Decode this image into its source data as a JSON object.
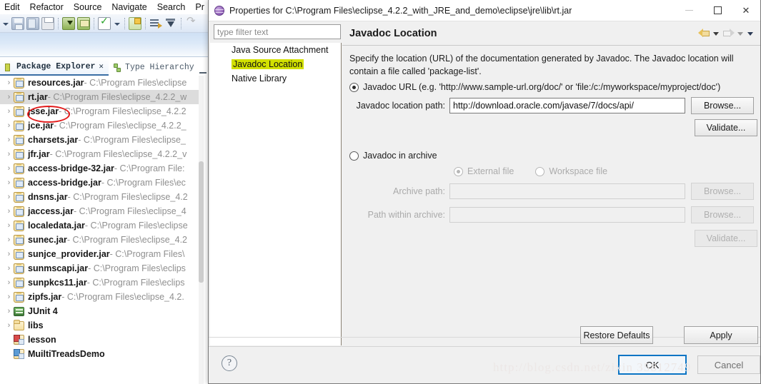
{
  "eclipse": {
    "menu": [
      "Edit",
      "Refactor",
      "Source",
      "Navigate",
      "Search",
      "Pr"
    ],
    "toolbar_icons": [
      "caret-down-icon",
      "save-icon",
      "save-all-icon",
      "print-icon",
      "export-icon",
      "update-icon",
      "check-icon",
      "caret-down-icon",
      "new-class-icon",
      "open-type-icon",
      "debug-tree-icon",
      "redo-icon"
    ],
    "view_tabs": [
      {
        "label": "Package Explorer",
        "icon": "package-icon",
        "close": "✕"
      },
      {
        "label": "Type Hierarchy",
        "icon": "hierarchy-icon",
        "close": ""
      }
    ],
    "tree": [
      {
        "name": "resources.jar",
        "path": " - C:\\Program Files\\eclipse",
        "icon": "jar-icon",
        "expander": "›",
        "selected": false
      },
      {
        "name": "rt.jar",
        "path": " - C:\\Program Files\\eclipse_4.2.2_w",
        "icon": "jar-icon",
        "expander": "›",
        "selected": true
      },
      {
        "name": "jsse.jar",
        "path": " - C:\\Program Files\\eclipse_4.2.2",
        "icon": "jar-icon",
        "expander": "›",
        "selected": false
      },
      {
        "name": "jce.jar",
        "path": " - C:\\Program Files\\eclipse_4.2.2_",
        "icon": "jar-icon",
        "expander": "›",
        "selected": false
      },
      {
        "name": "charsets.jar",
        "path": " - C:\\Program Files\\eclipse_",
        "icon": "jar-icon",
        "expander": "›",
        "selected": false
      },
      {
        "name": "jfr.jar",
        "path": " - C:\\Program Files\\eclipse_4.2.2_v",
        "icon": "jar-icon",
        "expander": "›",
        "selected": false
      },
      {
        "name": "access-bridge-32.jar",
        "path": " - C:\\Program File:",
        "icon": "jar-icon",
        "expander": "›",
        "selected": false
      },
      {
        "name": "access-bridge.jar",
        "path": " - C:\\Program Files\\ec",
        "icon": "jar-icon",
        "expander": "›",
        "selected": false
      },
      {
        "name": "dnsns.jar",
        "path": " - C:\\Program Files\\eclipse_4.2",
        "icon": "jar-icon",
        "expander": "›",
        "selected": false
      },
      {
        "name": "jaccess.jar",
        "path": " - C:\\Program Files\\eclipse_4",
        "icon": "jar-icon",
        "expander": "›",
        "selected": false
      },
      {
        "name": "localedata.jar",
        "path": " - C:\\Program Files\\eclipse",
        "icon": "jar-icon",
        "expander": "›",
        "selected": false
      },
      {
        "name": "sunec.jar",
        "path": " - C:\\Program Files\\eclipse_4.2",
        "icon": "jar-icon",
        "expander": "›",
        "selected": false
      },
      {
        "name": "sunjce_provider.jar",
        "path": " - C:\\Program Files\\",
        "icon": "jar-icon",
        "expander": "›",
        "selected": false
      },
      {
        "name": "sunmscapi.jar",
        "path": " - C:\\Program Files\\eclips",
        "icon": "jar-icon",
        "expander": "›",
        "selected": false
      },
      {
        "name": "sunpkcs11.jar",
        "path": " - C:\\Program Files\\eclips",
        "icon": "jar-icon",
        "expander": "›",
        "selected": false
      },
      {
        "name": "zipfs.jar",
        "path": " - C:\\Program Files\\eclipse_4.2.",
        "icon": "jar-icon",
        "expander": "›",
        "selected": false
      },
      {
        "name": "JUnit 4",
        "path": "",
        "icon": "junit-icon",
        "expander": "›",
        "selected": false
      },
      {
        "name": "libs",
        "path": "",
        "icon": "folder-icon",
        "expander": "›",
        "selected": false
      },
      {
        "name": "lesson",
        "path": "",
        "icon": "project-icon",
        "expander": "",
        "selected": false
      },
      {
        "name": "MuiltiTreadsDemo",
        "path": "",
        "icon": "project-blue-icon",
        "expander": "",
        "selected": false
      }
    ]
  },
  "dialog": {
    "title": "Properties for C:\\Program Files\\eclipse_4.2.2_with_JRE_and_demo\\eclipse\\jre\\lib\\rt.jar",
    "window_icon": "properties-icon",
    "window_controls": [
      {
        "name": "minimize",
        "glyph": "minus",
        "disabled": true
      },
      {
        "name": "maximize",
        "glyph": "square",
        "disabled": false
      },
      {
        "name": "close",
        "glyph": "✕",
        "disabled": false
      }
    ],
    "filter": {
      "placeholder": "type filter text",
      "value": ""
    },
    "nav_items": [
      {
        "label": "Java Source Attachment",
        "selected": false
      },
      {
        "label": "Javadoc Location",
        "selected": true
      },
      {
        "label": "Native Library",
        "selected": false
      }
    ],
    "page": {
      "heading": "Javadoc Location",
      "nav_icons": [
        "back-arrow-icon",
        "chevron-down-icon",
        "forward-arrow-icon",
        "chevron-down-icon",
        "chevron-down-icon"
      ],
      "description": "Specify the location (URL) of the documentation generated by Javadoc. The Javadoc location will contain a file called 'package-list'.",
      "radio_url_label": "Javadoc URL (e.g. 'http://www.sample-url.org/doc/' or 'file:/c:/myworkspace/myproject/doc')",
      "location_path_label": "Javadoc location path:",
      "location_path_value": "http://download.oracle.com/javase/7/docs/api/",
      "browse_label": "Browse...",
      "validate_label": "Validate...",
      "radio_archive_label": "Javadoc in archive",
      "external_file_label": "External file",
      "workspace_file_label": "Workspace file",
      "archive_path_label": "Archive path:",
      "archive_path_value": "",
      "archive_browse_label": "Browse...",
      "path_within_label": "Path within archive:",
      "path_within_value": "",
      "path_within_browse_label": "Browse...",
      "archive_validate_label": "Validate..."
    },
    "buttons": {
      "restore_defaults": "Restore Defaults",
      "apply": "Apply",
      "ok": "OK",
      "cancel": "Cancel",
      "help_icon": "?"
    }
  },
  "watermark": "http://blog.csdn.net/zixin 35812749",
  "colors": {
    "selection_highlight": "#d2e000",
    "focus_border": "#0a74c4",
    "annotation_red": "#e21b1b",
    "tree_selection": "#dcdcdc"
  }
}
